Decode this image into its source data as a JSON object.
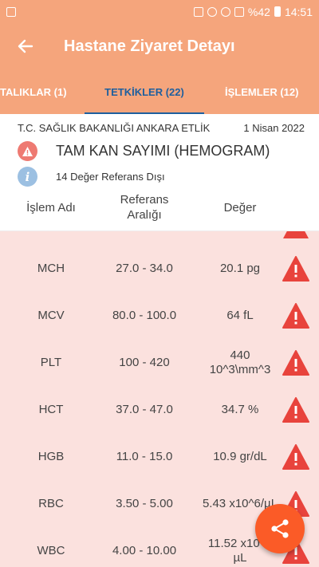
{
  "status_bar": {
    "battery": "%42",
    "time": "14:51"
  },
  "app_bar": {
    "title": "Hastane Ziyaret Detayı"
  },
  "tabs": [
    {
      "label": "TALIKLAR (1)"
    },
    {
      "label": "TETKİKLER (22)"
    },
    {
      "label": "İŞLEMLER (12)"
    }
  ],
  "card": {
    "institution": "T.C. SAĞLIK BAKANLIĞI ANKARA ETLİK",
    "date": "1 Nisan 2022",
    "test_name": "TAM KAN SAYIMI (HEMOGRAM)",
    "info": "14 Değer Referans Dışı"
  },
  "columns": {
    "name": "İşlem Adı",
    "ref": "Referans\nAralığı",
    "value": "Değer"
  },
  "results": [
    {
      "name": "MCH",
      "ref": "27.0 - 34.0",
      "value": "20.1 pg"
    },
    {
      "name": "MCV",
      "ref": "80.0 - 100.0",
      "value": "64 fL"
    },
    {
      "name": "PLT",
      "ref": "100 - 420",
      "value": "440\n10^3\\mm^3"
    },
    {
      "name": "HCT",
      "ref": "37.0 - 47.0",
      "value": "34.7 %"
    },
    {
      "name": "HGB",
      "ref": "11.0 - 15.0",
      "value": "10.9 gr/dL"
    },
    {
      "name": "RBC",
      "ref": "3.50 - 5.00",
      "value": "5.43 x10^6/µL"
    },
    {
      "name": "WBC",
      "ref": "4.00 - 10.00",
      "value": "11.52 x10^3\nµL"
    }
  ],
  "colors": {
    "header": "#f5a57c",
    "active_tab": "#1e5f9e",
    "row_bg": "#fbe1de",
    "warning": "#e8433c",
    "fab": "#fb5b27"
  },
  "icons": [
    "back-arrow-icon",
    "warning-icon",
    "info-icon",
    "share-icon"
  ]
}
